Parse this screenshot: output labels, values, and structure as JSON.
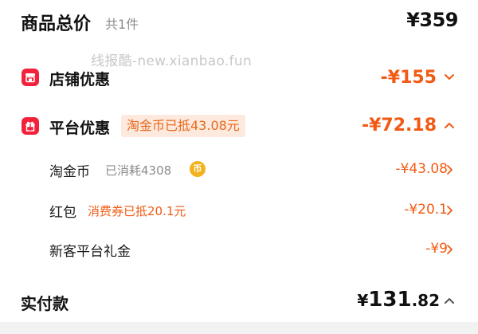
{
  "summary": {
    "total_label": "商品总价",
    "count_label": "共1件",
    "total_price": "¥359"
  },
  "watermark": "线报酷-new.xianbao.fun",
  "store_discount": {
    "icon": "store-icon",
    "label": "店铺优惠",
    "value": "-¥155"
  },
  "platform_discount": {
    "icon": "gift-icon",
    "label": "平台优惠",
    "badge": "淘金币已抵43.08元",
    "value": "-¥72.18",
    "items": [
      {
        "label": "淘金币",
        "note": "已消耗4308",
        "coin_glyph": "币",
        "value": "-¥43.08"
      },
      {
        "label": "红包",
        "note": "消费券已抵20.1元",
        "value": "-¥20.1"
      },
      {
        "label": "新客平台礼金",
        "value": "-¥9"
      }
    ]
  },
  "actual_payment": {
    "label": "实付款",
    "currency": "¥",
    "integer": "131",
    "decimal": ".82"
  },
  "colors": {
    "accent_orange": "#f25a14",
    "icon_red": "#f2213c",
    "badge_bg": "#fde9dd",
    "coin_gold": "#f2b21d"
  }
}
